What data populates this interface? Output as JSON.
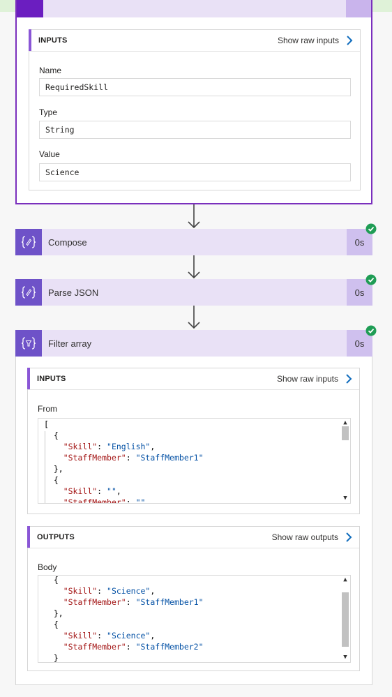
{
  "initialize_variable": {
    "inputs": {
      "title": "INPUTS",
      "link": "Show raw inputs",
      "fields": [
        {
          "label": "Name",
          "value": "RequiredSkill"
        },
        {
          "label": "Type",
          "value": "String"
        },
        {
          "label": "Value",
          "value": "Science"
        }
      ]
    }
  },
  "actions": [
    {
      "name": "Compose",
      "duration": "0s",
      "status": "succeeded"
    },
    {
      "name": "Parse JSON",
      "duration": "0s",
      "status": "succeeded"
    },
    {
      "name": "Filter array",
      "duration": "0s",
      "status": "succeeded"
    }
  ],
  "filter_array": {
    "inputs": {
      "title": "INPUTS",
      "link": "Show raw inputs",
      "from_label": "From",
      "from_code": [
        "[",
        "  {",
        "    \"Skill\": \"English\",",
        "    \"StaffMember\": \"StaffMember1\"",
        "  },",
        "  {",
        "    \"Skill\": \"\",",
        "    \"StaffMember\": \"\""
      ]
    },
    "outputs": {
      "title": "OUTPUTS",
      "link": "Show raw outputs",
      "body_label": "Body",
      "body_code": [
        "  {",
        "    \"Skill\": \"Science\",",
        "    \"StaffMember\": \"StaffMember1\"",
        "  },",
        "  {",
        "    \"Skill\": \"Science\",",
        "    \"StaffMember\": \"StaffMember2\"",
        "  }"
      ]
    }
  },
  "colors": {
    "card_border": "#7a2fbd",
    "action_header_bg": "#e9e1f6",
    "icon_bg": "#6e52c8",
    "success_green": "#1f9d55",
    "json_key": "#a31515",
    "json_string": "#0451a5"
  },
  "icons": {
    "action_icon": "curly-braces-icon",
    "filter_icon": "filter-braces-icon",
    "status_icon": "success-check-icon",
    "link_icon": "chevron-right-icon",
    "connector_icon": "arrow-down-icon"
  }
}
